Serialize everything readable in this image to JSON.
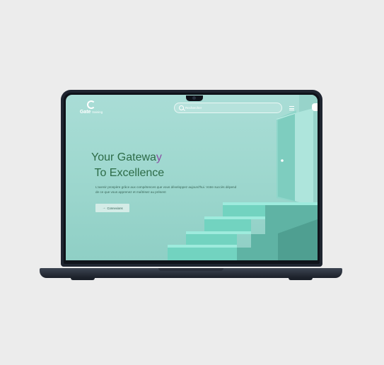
{
  "site": {
    "logo_letter": "G",
    "brand_name": "Gate",
    "brand_sub": "training",
    "search": {
      "placeholder": "Rechercher"
    },
    "hero": {
      "title_line1_a": "Your Gatewa",
      "title_line1_b": "y",
      "title_line2": "To Excellence",
      "description": "L'avenir prospère grâce aux compétences que vous développez aujourd'hui. Votre succès dépend de ce que vous apprenez et maîtrisez au présent",
      "cta_label": "Connexions"
    }
  },
  "colors": {
    "background": "#ececec",
    "screen_bg": "#a9ddd6",
    "heading": "#2d6b47",
    "accent": "#8a4fa3",
    "stairs": "#7fd9c9"
  },
  "icons": [
    "logo-mark",
    "search-icon",
    "menu-icon",
    "arrow-right-icon",
    "door-knob-icon"
  ]
}
